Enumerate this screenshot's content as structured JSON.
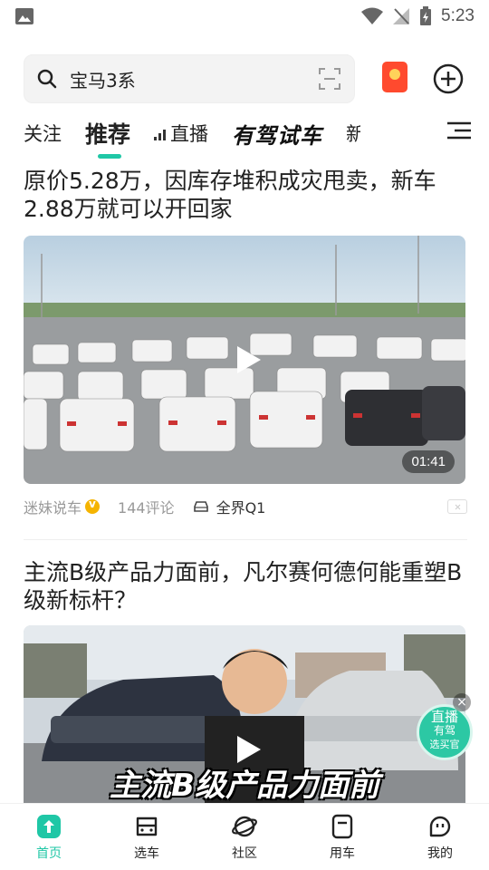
{
  "status_bar": {
    "time": "5:23"
  },
  "search": {
    "query": "宝马3系"
  },
  "tabs": [
    {
      "label": "关注"
    },
    {
      "label": "推荐",
      "active": true
    },
    {
      "label": "直播"
    },
    {
      "label": "有驾试车"
    },
    {
      "label": "新"
    }
  ],
  "articles": [
    {
      "title": "原价5.28万，因库存堆积成灾甩卖，新车2.88万就可以开回家",
      "duration": "01:41",
      "author": "迷妹说车",
      "comments": "144评论",
      "car": "全界Q1"
    },
    {
      "title": "主流B级产品力面前，凡尔赛何德何能重塑B级新标杆？",
      "caption": "主流B级产品力面前"
    }
  ],
  "live_badge": {
    "line1": "直播",
    "line2": "有驾",
    "line3": "选买官"
  },
  "bottom_nav": [
    {
      "label": "首页",
      "icon": "home-icon",
      "active": true
    },
    {
      "label": "选车",
      "icon": "car-select-icon"
    },
    {
      "label": "社区",
      "icon": "planet-icon"
    },
    {
      "label": "用车",
      "icon": "car-use-icon"
    },
    {
      "label": "我的",
      "icon": "profile-icon"
    }
  ],
  "colors": {
    "accent": "#1fc7a6",
    "redpacket": "#ff4a2e"
  }
}
